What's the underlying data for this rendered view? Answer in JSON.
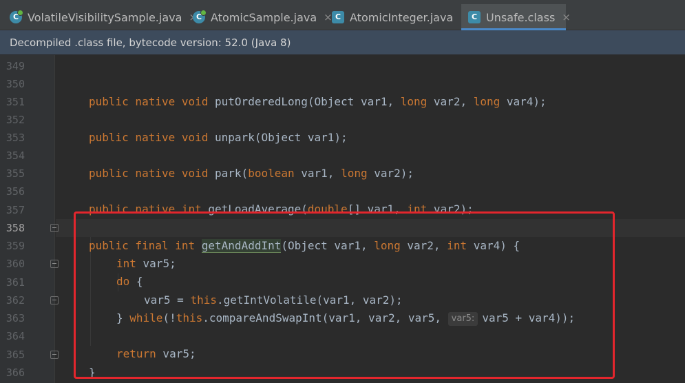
{
  "tabs": [
    {
      "label": "VolatileVisibilitySample.java",
      "icon": "java-class-icon",
      "close": "×"
    },
    {
      "label": "AtomicSample.java",
      "icon": "java-class-icon",
      "close": "×"
    },
    {
      "label": "AtomicInteger.java",
      "icon": "compiled-class-icon",
      "close": "×"
    },
    {
      "label": "Unsafe.class",
      "icon": "compiled-class-icon",
      "close": "×",
      "active": true
    }
  ],
  "banner": {
    "text": "Decompiled .class file, bytecode version: 52.0 (Java 8)"
  },
  "gutter": {
    "line_numbers": [
      "349",
      "350",
      "351",
      "352",
      "353",
      "354",
      "355",
      "356",
      "357",
      "358",
      "359",
      "360",
      "361",
      "362",
      "363",
      "364",
      "365",
      "366"
    ],
    "current_line": "358"
  },
  "code": {
    "l350": {
      "t1": "public native void",
      "t2": " putOrderedLong(Object var1, ",
      "t3": "long",
      "t4": " var2, ",
      "t5": "long",
      "t6": " var4);"
    },
    "l352": {
      "t1": "public native void",
      "t2": " unpark(Object var1);"
    },
    "l354": {
      "t1": "public native void",
      "t2": " park(",
      "t3": "boolean",
      "t4": " var1, ",
      "t5": "long",
      "t6": " var2);"
    },
    "l356": {
      "t1": "public native int",
      "t2": " getLoadAverage(",
      "t3": "double",
      "t4": "[] var1, ",
      "t5": "int",
      "t6": " var2);"
    },
    "l358": {
      "t1": "public final int",
      "t2": " ",
      "fn": "getAndAddInt",
      "t3": "(Object var1, ",
      "t4": "long",
      "t5": " var2, ",
      "t6": "int",
      "t7": " var4) {"
    },
    "l359": {
      "t1": "int",
      "t2": " var5;"
    },
    "l360": {
      "t1": "do",
      "t2": " {"
    },
    "l361": {
      "t1": "var5 = ",
      "t2": "this",
      "t3": ".getIntVolatile(var1, var2);"
    },
    "l362": {
      "t1": "} ",
      "t2": "while",
      "t3": "(!",
      "t4": "this",
      "t5": ".compareAndSwapInt(var1, var2, var5, ",
      "hint": "var5:",
      "t6": "var5 + var4));"
    },
    "l364": {
      "t1": "return",
      "t2": " var5;"
    },
    "l365": {
      "t1": "}"
    }
  },
  "colors": {
    "keyword": "#cc7832",
    "text": "#a9b7c6",
    "annotation_box": "#e3262d",
    "active_tab_underline": "#4a88c7"
  }
}
